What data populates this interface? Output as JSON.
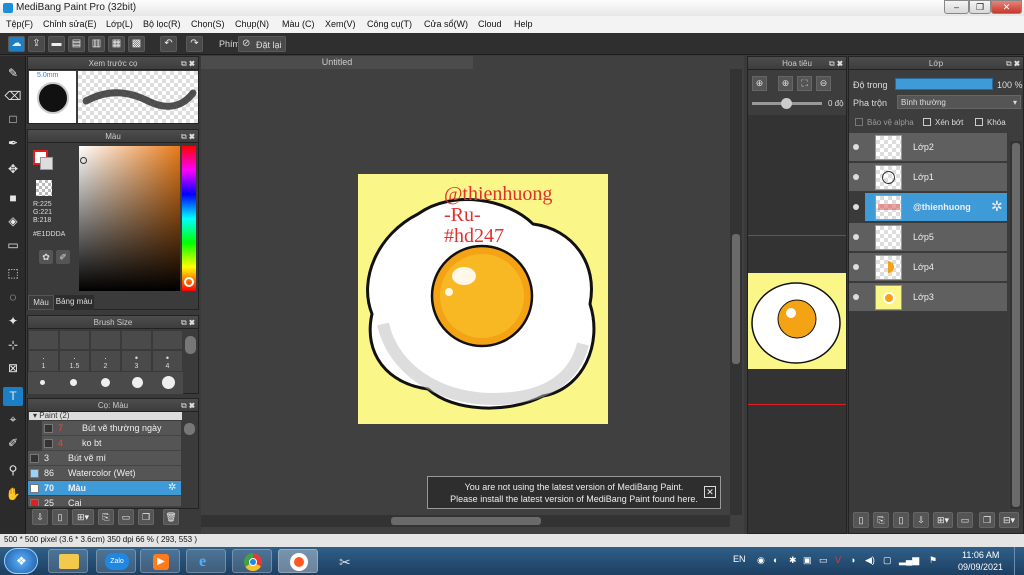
{
  "window": {
    "title": "MediBang Paint Pro (32bit)"
  },
  "menu": [
    "Tệp(F)",
    "Chỉnh sửa(E)",
    "Lớp(L)",
    "Bộ lọc(R)",
    "Chọn(S)",
    "Chụp(N)",
    "Màu (C)",
    "Xem(V)",
    "Công cụ(T)",
    "Cửa sổ(W)",
    "Cloud",
    "Help"
  ],
  "toolbar": {
    "shortcut_label": "Phím",
    "reset_label": "Đặt lại"
  },
  "preview_panel": {
    "title": "Xem trước cọ",
    "size": "5.0mm"
  },
  "color_panel": {
    "title": "Màu",
    "r": "R:225",
    "g": "G:221",
    "b": "B:218",
    "hex": "#E1DDDA",
    "tab_color": "Màu",
    "tab_palette": "Bảng màu"
  },
  "brushsize_panel": {
    "title": "Brush Size",
    "sizes": [
      "1",
      "1.5",
      "2",
      "3",
      "4"
    ]
  },
  "brush_panel": {
    "title": "Cọ: Màu",
    "group": "Paint (2)",
    "items": [
      {
        "num": "7",
        "name": "Bút vẽ thường ngày",
        "num_color": "#e0502a"
      },
      {
        "num": "4",
        "name": "ko bt",
        "num_color": "#e0502a"
      },
      {
        "num": "3",
        "name": "Bút vẽ mí",
        "num_color": "#eee"
      },
      {
        "num": "86",
        "name": "Watercolor (Wet)",
        "num_color": "#eee"
      },
      {
        "num": "70",
        "name": "Màu",
        "num_color": "#fff"
      },
      {
        "num": "25",
        "name": "Cai",
        "num_color": "#eee"
      }
    ]
  },
  "canvas": {
    "tab": "Untitled",
    "text_lines": [
      "@thienhuong",
      "-Ru-",
      "#hd247"
    ],
    "text_color": "#e03030",
    "bg": "#fbf688"
  },
  "notice": {
    "line1": "You are not using the latest version of MediBang Paint.",
    "line2": "Please install the latest version of MediBang Paint found here."
  },
  "navigator": {
    "title": "Hoa tiêu",
    "angle": "0 độ"
  },
  "layers_panel": {
    "title": "Lớp",
    "opacity_label": "Độ trong",
    "opacity_value": "100 %",
    "blend_label": "Pha trộn",
    "blend_value": "Bình thường",
    "protect_alpha": "Bảo vệ alpha",
    "clip": "Xén bớt",
    "lock": "Khóa",
    "layers": [
      "Lớp2",
      "Lớp1",
      "@thienhuong",
      "Lớp5",
      "Lớp4",
      "Lớp3"
    ]
  },
  "status": {
    "text": "500 * 500 pixel  (3.6 * 3.6cm)  350 dpi  66 %  ( 293, 553 )"
  },
  "taskbar": {
    "lang": "EN",
    "time": "11:06 AM",
    "date": "09/09/2021",
    "zalo": "Zalo"
  }
}
